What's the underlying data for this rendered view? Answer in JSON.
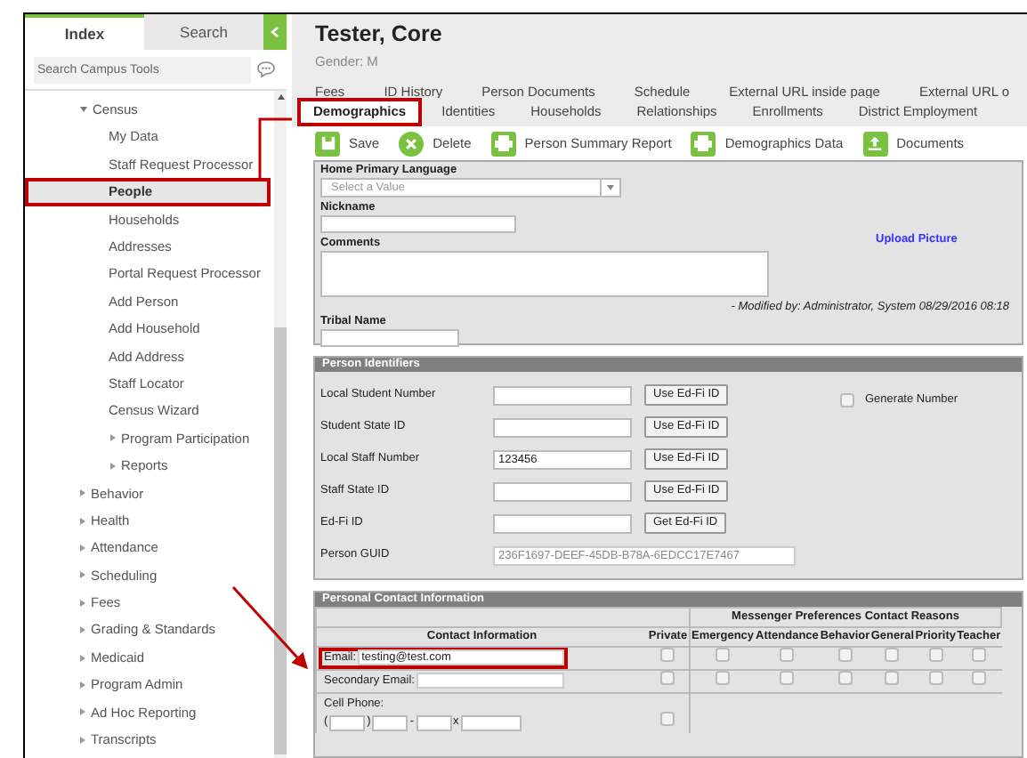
{
  "sidebar": {
    "tabs": [
      {
        "label": "Index",
        "selected": true
      },
      {
        "label": "Search",
        "selected": false
      }
    ],
    "search": {
      "placeholder": "Search Campus Tools"
    },
    "tree": [
      {
        "label": "Census",
        "kind": "folder",
        "expanded": true,
        "selected": false,
        "highlighted": false,
        "children": [
          {
            "label": "My Data",
            "kind": "page",
            "selected": false,
            "highlighted": false
          },
          {
            "label": "Staff Request Processor",
            "kind": "page",
            "selected": false,
            "highlighted": false
          },
          {
            "label": "People",
            "kind": "page",
            "selected": true,
            "highlighted": true
          },
          {
            "label": "Households",
            "kind": "page",
            "selected": false,
            "highlighted": false
          },
          {
            "label": "Addresses",
            "kind": "page",
            "selected": false,
            "highlighted": false
          },
          {
            "label": "Portal Request Processor",
            "kind": "page",
            "selected": false,
            "highlighted": false
          },
          {
            "label": "Add Person",
            "kind": "page",
            "selected": false,
            "highlighted": false
          },
          {
            "label": "Add Household",
            "kind": "page",
            "selected": false,
            "highlighted": false
          },
          {
            "label": "Add Address",
            "kind": "page",
            "selected": false,
            "highlighted": false
          },
          {
            "label": "Staff Locator",
            "kind": "page",
            "selected": false,
            "highlighted": false
          },
          {
            "label": "Census Wizard",
            "kind": "page",
            "selected": false,
            "highlighted": false
          },
          {
            "label": "Program Participation",
            "kind": "folder",
            "expanded": false,
            "selected": false,
            "highlighted": false
          },
          {
            "label": "Reports",
            "kind": "folder",
            "expanded": false,
            "selected": false,
            "highlighted": false
          }
        ]
      },
      {
        "label": "Behavior",
        "kind": "folder",
        "expanded": false,
        "selected": false,
        "highlighted": false
      },
      {
        "label": "Health",
        "kind": "folder",
        "expanded": false,
        "selected": false,
        "highlighted": false
      },
      {
        "label": "Attendance",
        "kind": "folder",
        "expanded": false,
        "selected": false,
        "highlighted": false
      },
      {
        "label": "Scheduling",
        "kind": "folder",
        "expanded": false,
        "selected": false,
        "highlighted": false
      },
      {
        "label": "Fees",
        "kind": "folder",
        "expanded": false,
        "selected": false,
        "highlighted": false
      },
      {
        "label": "Grading & Standards",
        "kind": "folder",
        "expanded": false,
        "selected": false,
        "highlighted": false
      },
      {
        "label": "Medicaid",
        "kind": "folder",
        "expanded": false,
        "selected": false,
        "highlighted": false
      },
      {
        "label": "Program Admin",
        "kind": "folder",
        "expanded": false,
        "selected": false,
        "highlighted": false
      },
      {
        "label": "Ad Hoc Reporting",
        "kind": "folder",
        "expanded": false,
        "selected": false,
        "highlighted": false
      },
      {
        "label": "Transcripts",
        "kind": "folder",
        "expanded": false,
        "selected": false,
        "highlighted": false
      }
    ]
  },
  "person": {
    "name": "Tester, Core",
    "gender": "Gender: M"
  },
  "tabs_row_1": [
    {
      "label": "Fees",
      "selected": false
    },
    {
      "label": "ID History",
      "selected": false
    },
    {
      "label": "Person Documents",
      "selected": false
    },
    {
      "label": "Schedule",
      "selected": false
    },
    {
      "label": "External URL inside page",
      "selected": false
    },
    {
      "label": "External URL o",
      "selected": false
    }
  ],
  "tabs_row_2": [
    {
      "label": "Demographics",
      "selected": true,
      "highlighted": true
    },
    {
      "label": "Identities",
      "selected": false,
      "highlighted": false
    },
    {
      "label": "Households",
      "selected": false,
      "highlighted": false
    },
    {
      "label": "Relationships",
      "selected": false,
      "highlighted": false
    },
    {
      "label": "Enrollments",
      "selected": false,
      "highlighted": false
    },
    {
      "label": "District Employment",
      "selected": false,
      "highlighted": false
    }
  ],
  "toolbar": [
    {
      "label": "Save",
      "kind": "save"
    },
    {
      "label": "Delete",
      "kind": "delete"
    },
    {
      "label": "Person Summary Report",
      "kind": "print"
    },
    {
      "label": "Demographics Data",
      "kind": "print"
    },
    {
      "label": "Documents",
      "kind": "upload"
    }
  ],
  "demographics": {
    "home_primary_language": {
      "label": "Home Primary Language",
      "placeholder": "Select a Value"
    },
    "nickname": {
      "label": "Nickname"
    },
    "comments": {
      "label": "Comments"
    },
    "upload_link": "Upload Picture",
    "modified": "- Modified by: Administrator, System 08/29/2016 08:18",
    "tribal_name": {
      "label": "Tribal Name"
    }
  },
  "person_identifiers": {
    "title": "Person Identifiers",
    "rows": [
      {
        "label": "Local Student Number",
        "button": "Use Ed-Fi ID"
      },
      {
        "label": "Student State ID",
        "button": "Use Ed-Fi ID"
      },
      {
        "label": "Local Staff Number",
        "value": "123456",
        "button": "Use Ed-Fi ID"
      },
      {
        "label": "Staff State ID",
        "button": "Use Ed-Fi ID"
      },
      {
        "label": "Ed-Fi ID",
        "button": "Get Ed-Fi ID"
      }
    ],
    "generate_number": {
      "label": "Generate Number",
      "checked": false
    },
    "guid": {
      "label": "Person GUID",
      "value": "236F1697-DEEF-45DB-B78A-6EDCC17E7467"
    }
  },
  "contact": {
    "title": "Personal Contact Information",
    "group_heading": "Messenger Preferences Contact Reasons",
    "columns": [
      "Contact Information",
      "Private",
      "Emergency",
      "Attendance",
      "Behavior",
      "General",
      "Priority",
      "Teacher"
    ],
    "rows": [
      {
        "kind": "email",
        "label": "Email:",
        "value": "testing@test.com",
        "highlighted": true,
        "private": false,
        "reasons": [
          false,
          false,
          false,
          false,
          false,
          false
        ]
      },
      {
        "kind": "email",
        "label": "Secondary Email:",
        "highlighted": false,
        "private": false,
        "reasons": [
          false,
          false,
          false,
          false,
          false,
          false
        ]
      },
      {
        "kind": "phone",
        "label": "Cell Phone:",
        "marks": [
          "(",
          ")",
          "-",
          "x"
        ],
        "highlighted": false,
        "private": false
      }
    ]
  }
}
